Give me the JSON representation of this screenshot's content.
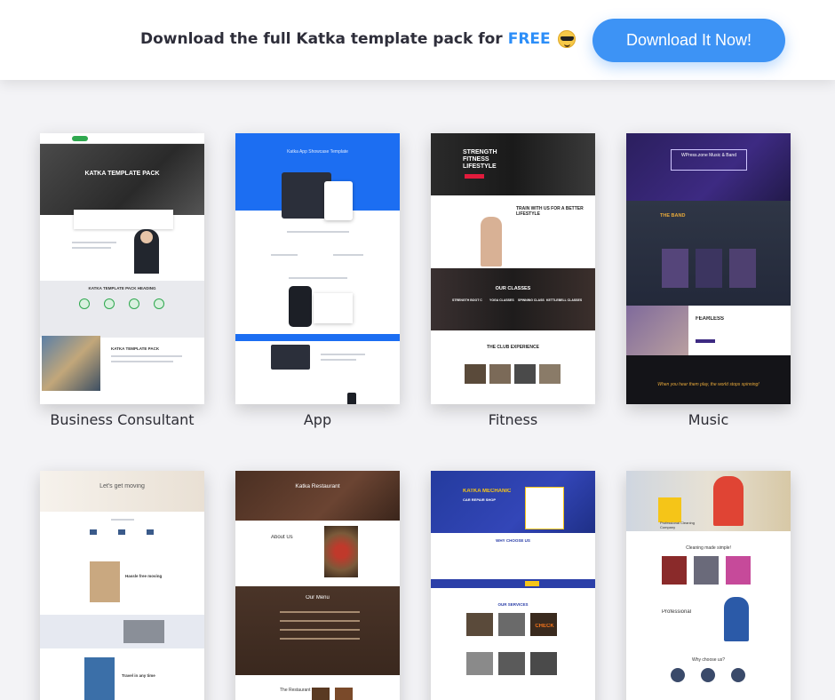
{
  "banner": {
    "text": "Download the full Katka template pack for",
    "free_label": "FREE",
    "emoji": "sunglasses-face-icon",
    "button_label": "Download It Now!"
  },
  "templates": [
    {
      "name": "Business Consultant",
      "preview": {
        "hero_title": "KATKA TEMPLATE PACK",
        "section_title": "KATKA TEMPLATE PACK HEADING",
        "footer_title": "KATKA TEMPLATE PACK"
      }
    },
    {
      "name": "App",
      "preview": {
        "hero_title": "Katka App Showcase Template"
      }
    },
    {
      "name": "Fitness",
      "preview": {
        "hero_title": "STRENGTH FITNESS LIFESTYLE",
        "section_title": "TRAIN WITH US FOR A BETTER LIFESTYLE",
        "classes_title": "OUR CLASSES",
        "classes": [
          "STRENGTH BOOT CAMP",
          "YOGA CLASSES",
          "SPINNING CLASSES",
          "KETTLEBELL CLASSES"
        ],
        "experience_title": "THE CLUB EXPERIENCE"
      }
    },
    {
      "name": "Music",
      "preview": {
        "hero_title": "WPress.zone Music & Band",
        "band_title": "THE BAND",
        "feature_title": "FEARLESS",
        "quote": "When you hear them play, the world stops spinning!"
      }
    },
    {
      "name": "",
      "preview": {
        "hero_title": "Let's get moving",
        "section_title": "Hassle free moving",
        "footer_title": "Travel in any time"
      }
    },
    {
      "name": "",
      "preview": {
        "hero_title": "Katka Restaurant",
        "about_title": "About Us",
        "menu_title": "Our Menu",
        "footer_title": "The Restaurant"
      }
    },
    {
      "name": "",
      "preview": {
        "hero_title": "KATKA MECHANIC",
        "hero_sub": "CAR REPAIR SHOP",
        "why_title": "WHY CHOOSE US",
        "services_title": "OUR SERVICES",
        "check_label": "CHECK"
      }
    },
    {
      "name": "",
      "preview": {
        "hero_sub": "Professional Cleaning Company",
        "section_title": "Cleaning made simple!",
        "pro_title": "Professional",
        "why_title": "Why choose us?"
      }
    }
  ],
  "colors": {
    "accent": "#3d93f5",
    "free": "#2c8ef8",
    "background": "#f3f3f6"
  }
}
